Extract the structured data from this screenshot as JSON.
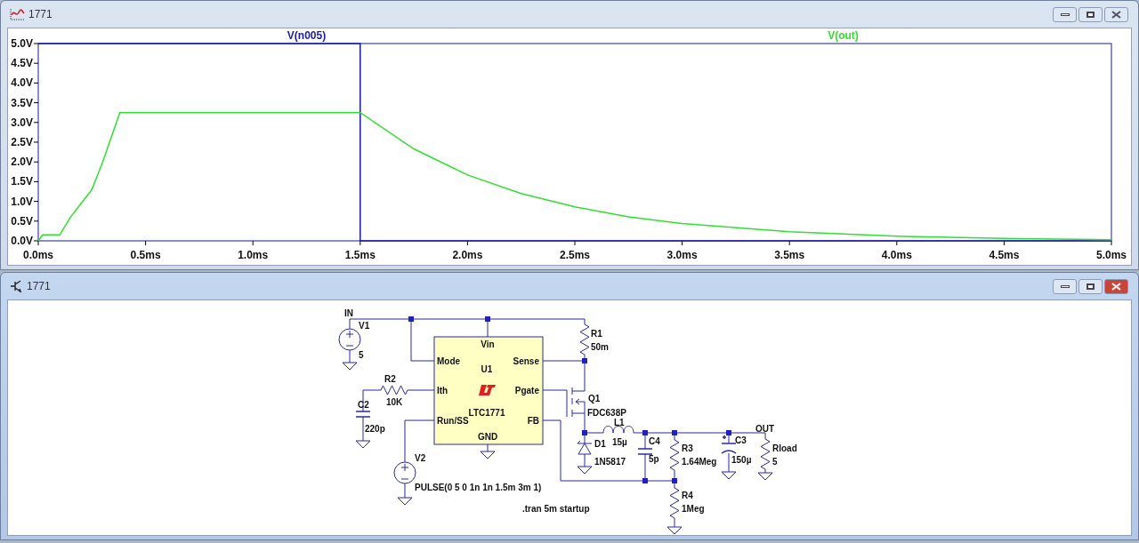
{
  "waveform_window": {
    "title": "1771",
    "active": false,
    "chart_data": {
      "type": "line",
      "x": [
        0,
        0.02,
        0.05,
        0.1,
        0.15,
        0.2,
        0.25,
        0.3,
        0.38,
        0.5,
        1.0,
        1.5,
        1.5,
        1.75,
        2.0,
        2.25,
        2.5,
        2.75,
        3.0,
        3.5,
        4.0,
        4.5,
        5.0
      ],
      "series": [
        {
          "name": "V(n005)",
          "color": "#1a1aa6",
          "values": [
            5,
            5,
            5,
            5,
            5,
            5,
            5,
            5,
            5,
            5,
            5,
            5,
            0,
            0,
            0,
            0,
            0,
            0,
            0,
            0,
            0,
            0,
            0
          ]
        },
        {
          "name": "V(out)",
          "color": "#33dd33",
          "values": [
            0,
            0.15,
            0.15,
            0.15,
            0.6,
            0.95,
            1.3,
            2.0,
            3.25,
            3.25,
            3.25,
            3.25,
            3.25,
            2.33,
            1.67,
            1.2,
            0.86,
            0.61,
            0.44,
            0.23,
            0.12,
            0.06,
            0.03
          ]
        }
      ],
      "xlim": [
        0,
        5
      ],
      "ylim": [
        0,
        5
      ],
      "xticks": [
        {
          "value": 0,
          "label": "0.0ms"
        },
        {
          "value": 0.5,
          "label": "0.5ms"
        },
        {
          "value": 1,
          "label": "1.0ms"
        },
        {
          "value": 1.5,
          "label": "1.5ms"
        },
        {
          "value": 2,
          "label": "2.0ms"
        },
        {
          "value": 2.5,
          "label": "2.5ms"
        },
        {
          "value": 3,
          "label": "3.0ms"
        },
        {
          "value": 3.5,
          "label": "3.5ms"
        },
        {
          "value": 4,
          "label": "4.0ms"
        },
        {
          "value": 4.5,
          "label": "4.5ms"
        },
        {
          "value": 5,
          "label": "5.0ms"
        }
      ],
      "yticks": [
        {
          "value": 0,
          "label": "0.0V"
        },
        {
          "value": 0.5,
          "label": "0.5V"
        },
        {
          "value": 1,
          "label": "1.0V"
        },
        {
          "value": 1.5,
          "label": "1.5V"
        },
        {
          "value": 2,
          "label": "2.0V"
        },
        {
          "value": 2.5,
          "label": "2.5V"
        },
        {
          "value": 3,
          "label": "3.0V"
        },
        {
          "value": 3.5,
          "label": "3.5V"
        },
        {
          "value": 4,
          "label": "4.0V"
        },
        {
          "value": 4.5,
          "label": "4.5V"
        },
        {
          "value": 5,
          "label": "5.0V"
        }
      ]
    }
  },
  "schematic_window": {
    "title": "1771",
    "active": true,
    "schematic": {
      "components": [
        {
          "kind": "voltage_source",
          "ref": "V1",
          "value": "5"
        },
        {
          "kind": "ic",
          "ref": "U1",
          "value": "LTC1771"
        },
        {
          "kind": "resistor",
          "ref": "R1",
          "value": "50m"
        },
        {
          "kind": "resistor",
          "ref": "R2",
          "value": "10K"
        },
        {
          "kind": "capacitor",
          "ref": "C2",
          "value": "220p"
        },
        {
          "kind": "pmos",
          "ref": "Q1",
          "value": "FDC638P"
        },
        {
          "kind": "inductor",
          "ref": "L1",
          "value": "15µ"
        },
        {
          "kind": "diode",
          "ref": "D1",
          "value": "1N5817"
        },
        {
          "kind": "capacitor",
          "ref": "C4",
          "value": "5p"
        },
        {
          "kind": "resistor",
          "ref": "R3",
          "value": "1.64Meg"
        },
        {
          "kind": "polar_capacitor",
          "ref": "C3",
          "value": "150µ"
        },
        {
          "kind": "resistor",
          "ref": "Rload",
          "value": "5"
        },
        {
          "kind": "voltage_source",
          "ref": "V2",
          "value": "PULSE(0 5 0 1n 1n 1.5m 3m 1)"
        },
        {
          "kind": "resistor",
          "ref": "R4",
          "value": "1Meg"
        }
      ],
      "pins": [
        "Vin",
        "Mode",
        "Sense",
        "Ith",
        "Pgate",
        "Run/SS",
        "FB",
        "GND"
      ],
      "net_labels": [
        "IN",
        "OUT"
      ],
      "directive": ".tran 5m startup"
    }
  }
}
